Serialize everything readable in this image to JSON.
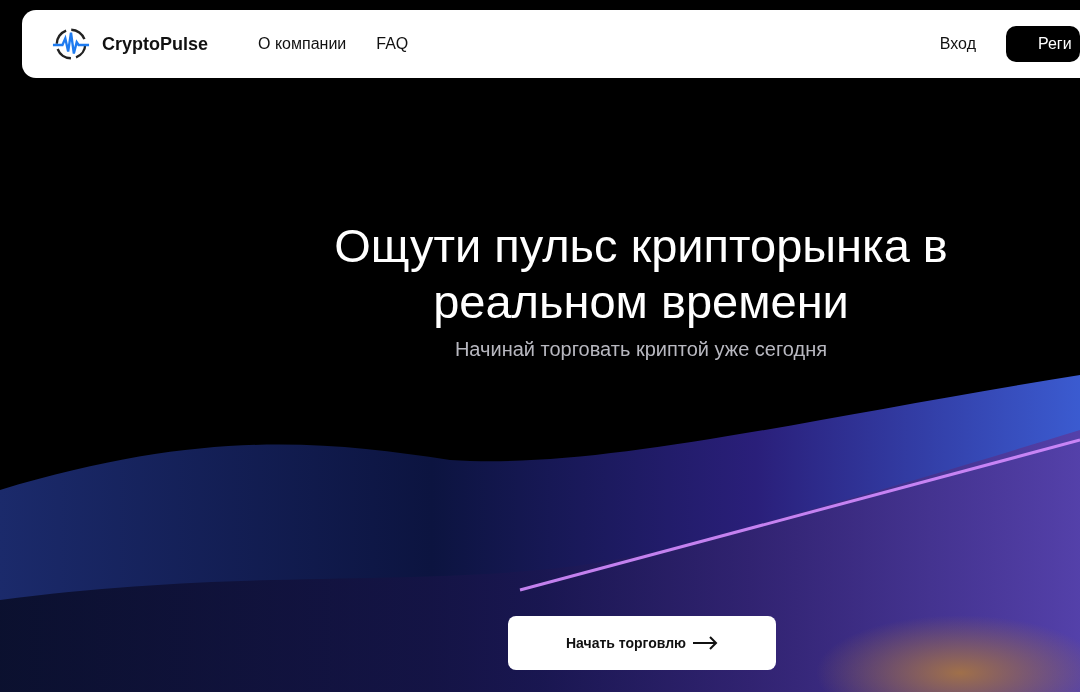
{
  "header": {
    "logo": "CryptoPulse",
    "nav": [
      "О компании",
      "FAQ"
    ],
    "login": "Вход",
    "register": "Реги"
  },
  "hero": {
    "title": "Ощути пульс крипторынка в реальном времени",
    "subtitle": "Начинай торговать криптой уже сегодня",
    "cta": "Начать торговлю"
  }
}
